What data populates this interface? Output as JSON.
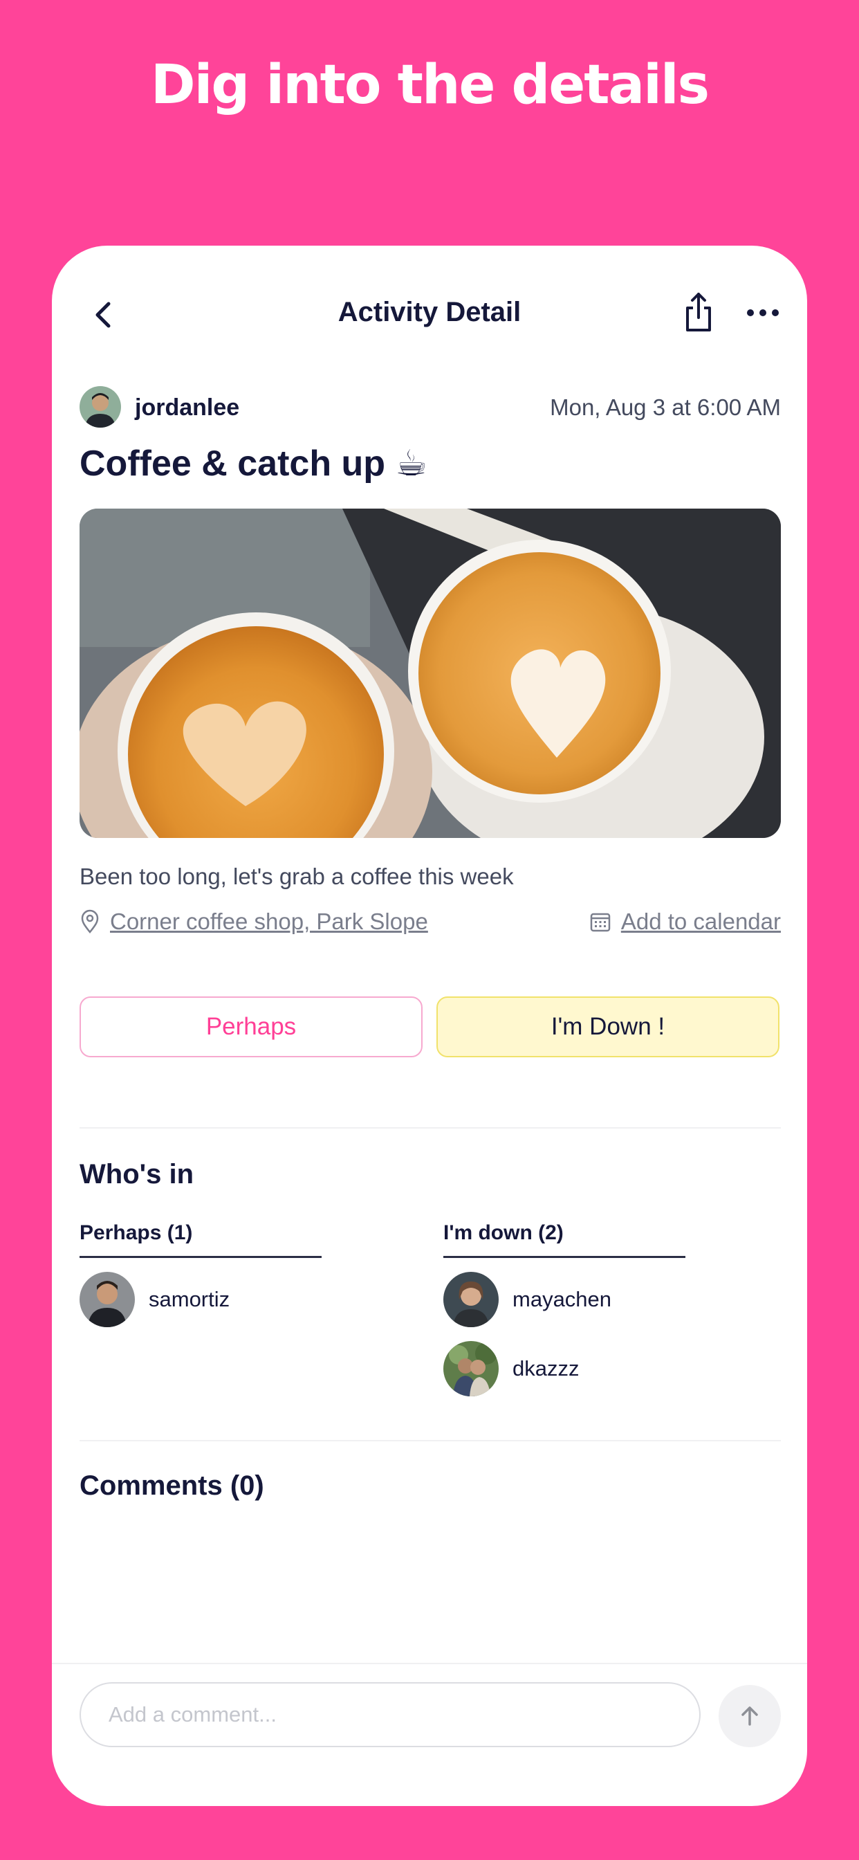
{
  "headline": "Dig into the details",
  "nav": {
    "title": "Activity Detail"
  },
  "post": {
    "author": "jordanlee",
    "datetime": "Mon, Aug 3 at 6:00 AM",
    "title": "Coffee & catch up ☕",
    "description": "Been too long, let's grab a coffee this week",
    "location": "Corner coffee shop, Park Slope",
    "calendar_link": "Add to calendar"
  },
  "rsvp": {
    "perhaps_label": "Perhaps",
    "down_label": "I'm Down !"
  },
  "whos_in": {
    "title": "Who's in",
    "perhaps": {
      "header": "Perhaps  (1)",
      "people": [
        "samortiz"
      ]
    },
    "down": {
      "header": "I'm down  (2)",
      "people": [
        "mayachen",
        "dkazzz"
      ]
    }
  },
  "comments": {
    "title": "Comments (0)",
    "placeholder": "Add a comment..."
  },
  "colors": {
    "brand_pink": "#ff4499",
    "text_navy": "#15183a",
    "down_fill": "#fff8cf",
    "perhaps_text": "#ff3f96"
  }
}
